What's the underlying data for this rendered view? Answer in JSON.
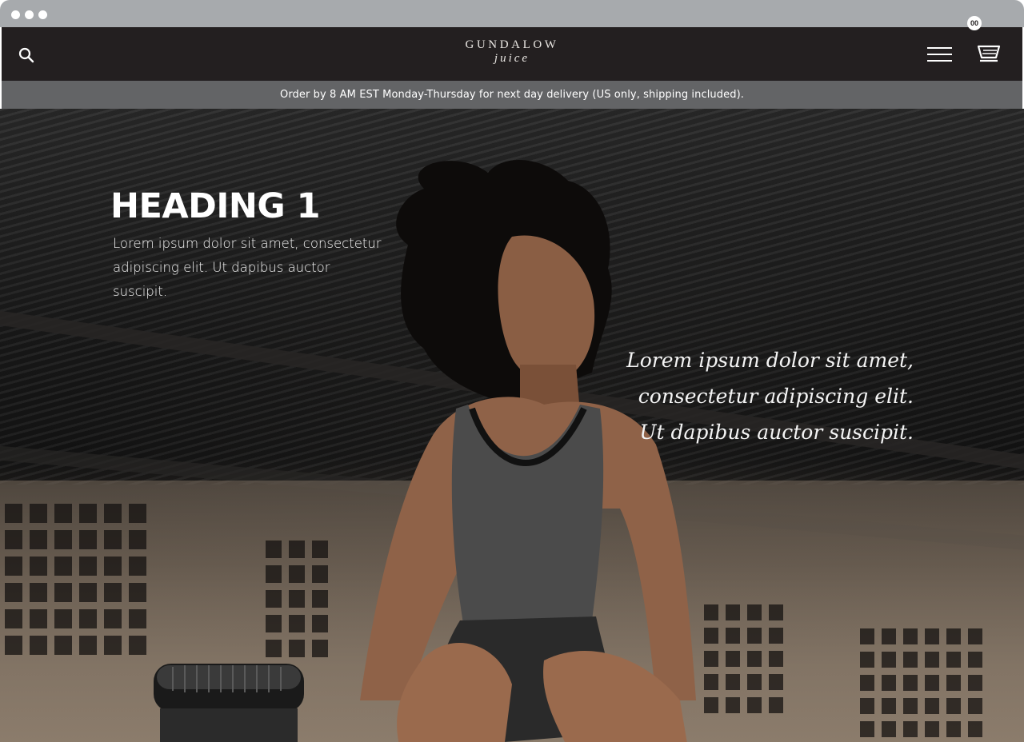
{
  "site": {
    "logo_top": "GUNDALOW",
    "logo_bottom": "juice",
    "cart_count": "00",
    "icons": {
      "search": "search-icon",
      "menu": "hamburger-menu-icon",
      "cart": "cart-icon"
    }
  },
  "announcement": {
    "text": "Order by 8 AM EST Monday-Thursday for next day delivery (US only, shipping included)."
  },
  "hero": {
    "heading": "HEADING 1",
    "body": "Lorem ipsum dolor sit amet, consectetur adipiscing elit. Ut dapibus auctor suscipit.",
    "quote": "Lorem ipsum dolor sit amet, consectetur adipiscing elit. Ut dapibus auctor suscipit."
  },
  "colors": {
    "header_bg": "#231f20",
    "announcement_bg": "#636466",
    "browser_chrome": "#a7aaad"
  }
}
